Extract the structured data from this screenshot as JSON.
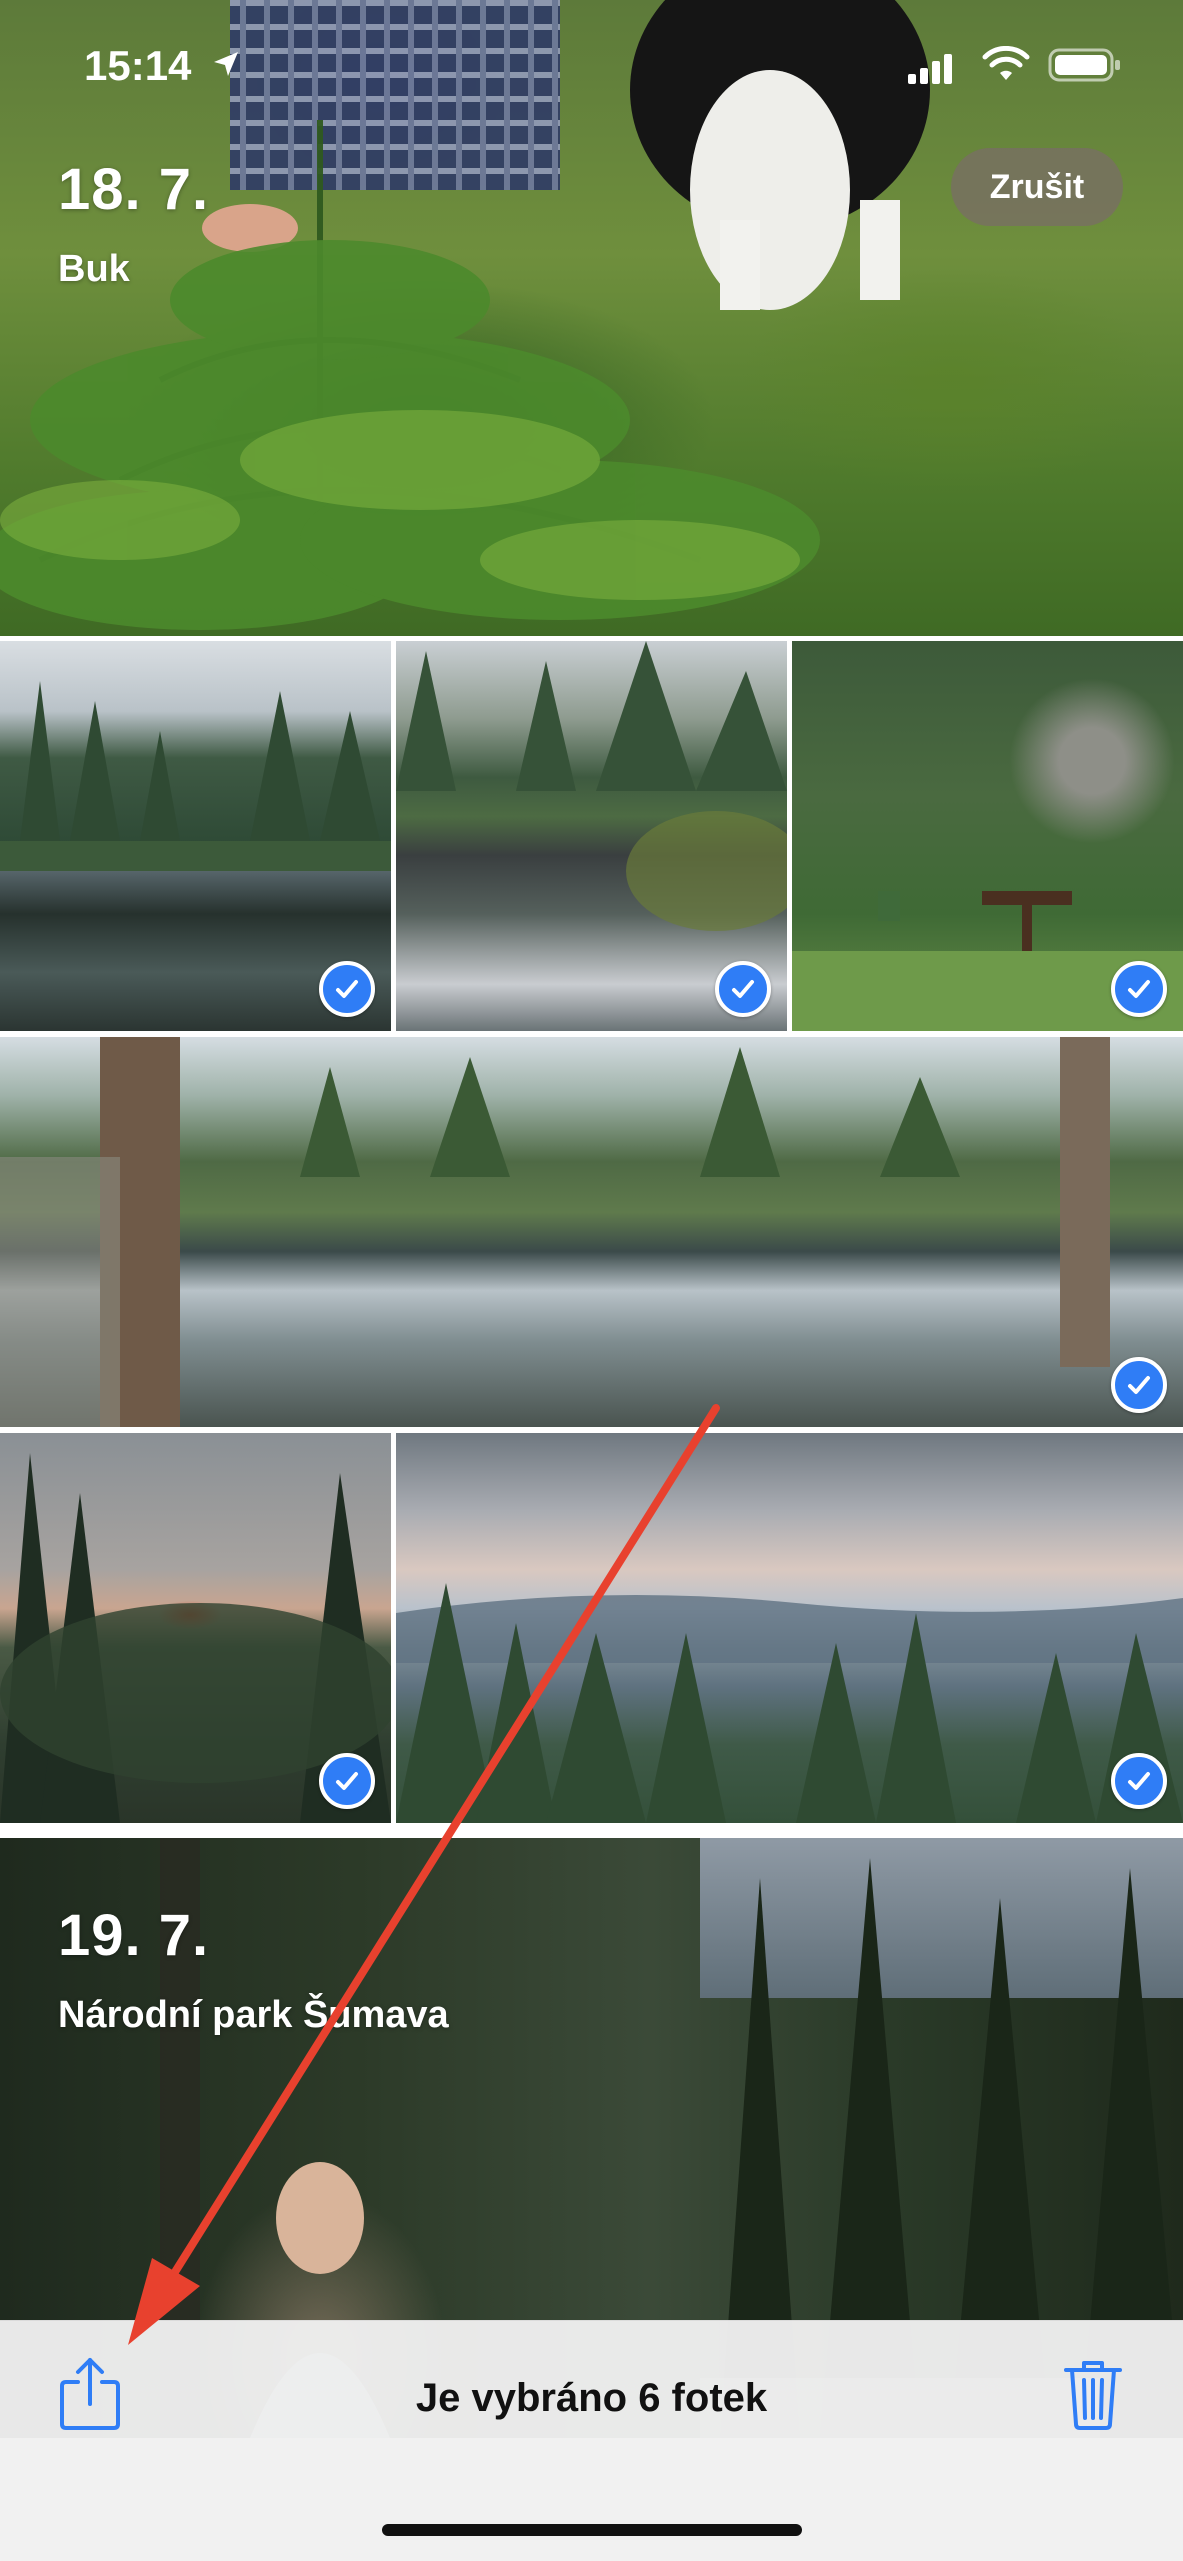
{
  "status_bar": {
    "time": "15:14",
    "icons": [
      "location-arrow-icon",
      "cellular-signal-icon",
      "wifi-icon",
      "battery-icon"
    ]
  },
  "header": {
    "cancel_label": "Zrušit"
  },
  "sections": [
    {
      "date": "18. 7.",
      "place": "Buk"
    },
    {
      "date": "19. 7.",
      "place": "Národní park Šumava"
    }
  ],
  "grid": {
    "photos": [
      {
        "subject": "forest lake reflection",
        "selected": true
      },
      {
        "subject": "lake reflection with sky",
        "selected": true
      },
      {
        "subject": "rock wall with shelter",
        "selected": true
      },
      {
        "subject": "panorama lake with forest",
        "selected": true
      },
      {
        "subject": "sunset over forest",
        "selected": true
      },
      {
        "subject": "mountain landscape",
        "selected": true
      }
    ]
  },
  "toolbar": {
    "selection_text": "Je vybráno 6 fotek",
    "share_icon": "share-icon",
    "delete_icon": "trash-icon"
  },
  "colors": {
    "accent": "#2f7df6",
    "annotation_arrow": "#e8412e"
  }
}
